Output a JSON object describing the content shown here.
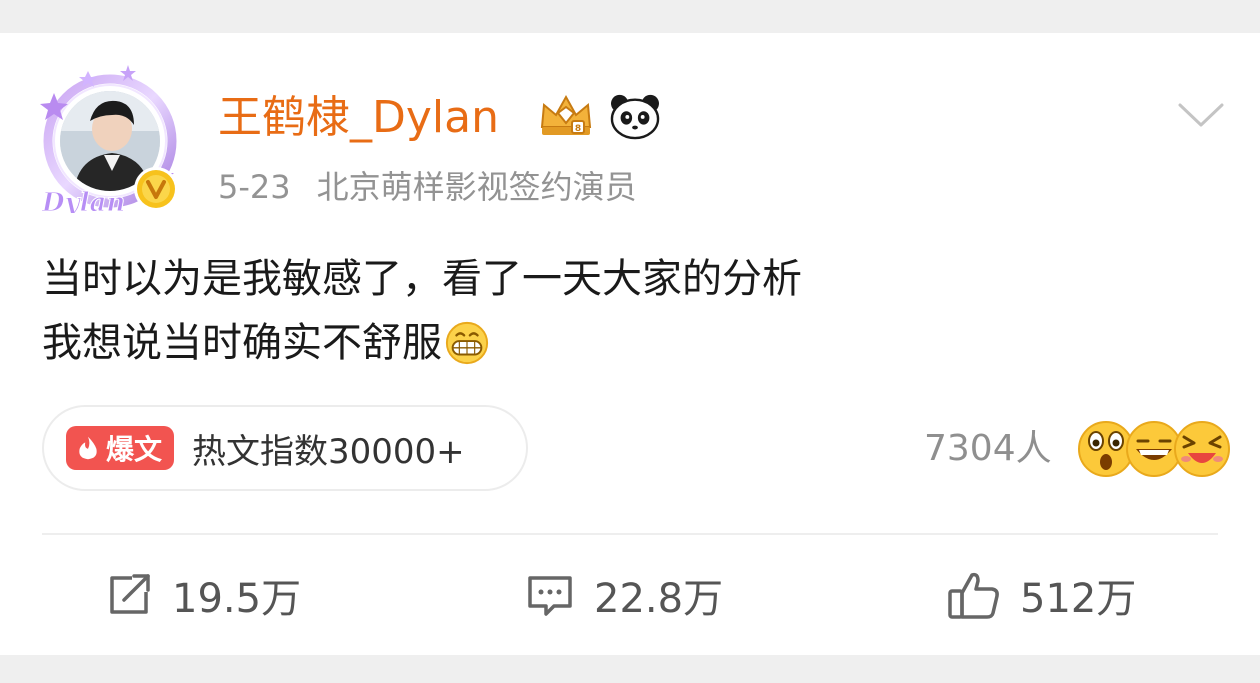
{
  "post": {
    "username": "王鹤棣_Dylan",
    "date": "5-23",
    "bio": "北京萌样影视签约演员",
    "lines": [
      "当时以为是我敏感了，看了一天大家的分析",
      "我想说当时确实不舒服"
    ],
    "avatar_label": "Dylan"
  },
  "hot": {
    "badge": "爆文",
    "text": "热文指数30000+"
  },
  "reactions": {
    "count": "7304人"
  },
  "actions": {
    "repost": "19.5万",
    "comment": "22.8万",
    "like": "512万"
  },
  "colors": {
    "username": "#e86c15",
    "hot_badge": "#f25450",
    "muted": "#939393"
  },
  "icons": {
    "crown": "crown-diamond-icon",
    "panda": "panda-icon",
    "verified": "verified-v-icon",
    "chevron": "chevron-down-icon",
    "repost": "repost-icon",
    "comment": "comment-icon",
    "like": "thumbs-up-icon"
  }
}
